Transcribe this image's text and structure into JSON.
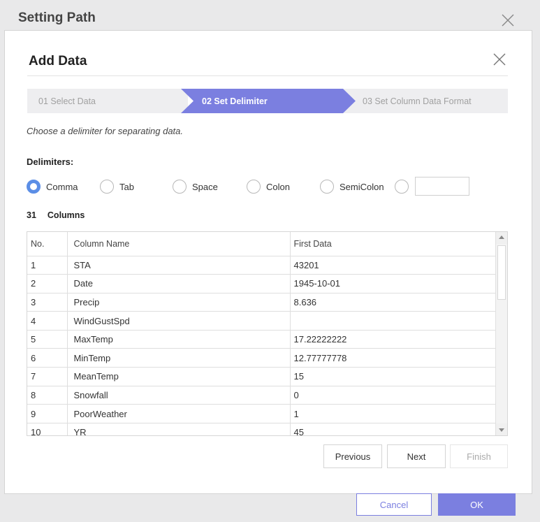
{
  "outer": {
    "title": "Setting Path",
    "cancel_label": "Cancel",
    "ok_label": "OK"
  },
  "dialog": {
    "title": "Add Data",
    "steps": [
      {
        "label": "01 Select Data",
        "state": "done"
      },
      {
        "label": "02 Set Delimiter",
        "state": "active"
      },
      {
        "label": "03 Set Column Data Format",
        "state": "pending"
      }
    ],
    "instruction": "Choose a delimiter for separating data.",
    "delimiters_label": "Delimiters:",
    "delimiters": [
      {
        "label": "Comma",
        "checked": true
      },
      {
        "label": "Tab",
        "checked": false
      },
      {
        "label": "Space",
        "checked": false
      },
      {
        "label": "Colon",
        "checked": false
      },
      {
        "label": "SemiColon",
        "checked": false
      },
      {
        "label": "",
        "checked": false
      }
    ],
    "custom_delimiter_value": "",
    "column_count": "31",
    "column_count_label": "Columns",
    "table": {
      "headers": [
        "No.",
        "Column Name",
        "First Data"
      ],
      "rows": [
        [
          "1",
          "STA",
          "43201"
        ],
        [
          "2",
          "Date",
          "1945-10-01"
        ],
        [
          "3",
          "Precip",
          "8.636"
        ],
        [
          "4",
          "WindGustSpd",
          ""
        ],
        [
          "5",
          "MaxTemp",
          "17.22222222"
        ],
        [
          "6",
          "MinTemp",
          "12.77777778"
        ],
        [
          "7",
          "MeanTemp",
          "15"
        ],
        [
          "8",
          "Snowfall",
          "0"
        ],
        [
          "9",
          "PoorWeather",
          "1"
        ],
        [
          "10",
          "YR",
          "45"
        ]
      ]
    },
    "buttons": {
      "previous": "Previous",
      "next": "Next",
      "finish": "Finish"
    }
  },
  "colors": {
    "accent": "#7b7fe0",
    "radio_checked": "#5b8ee6",
    "step_inactive_bg": "#eeeef0"
  }
}
